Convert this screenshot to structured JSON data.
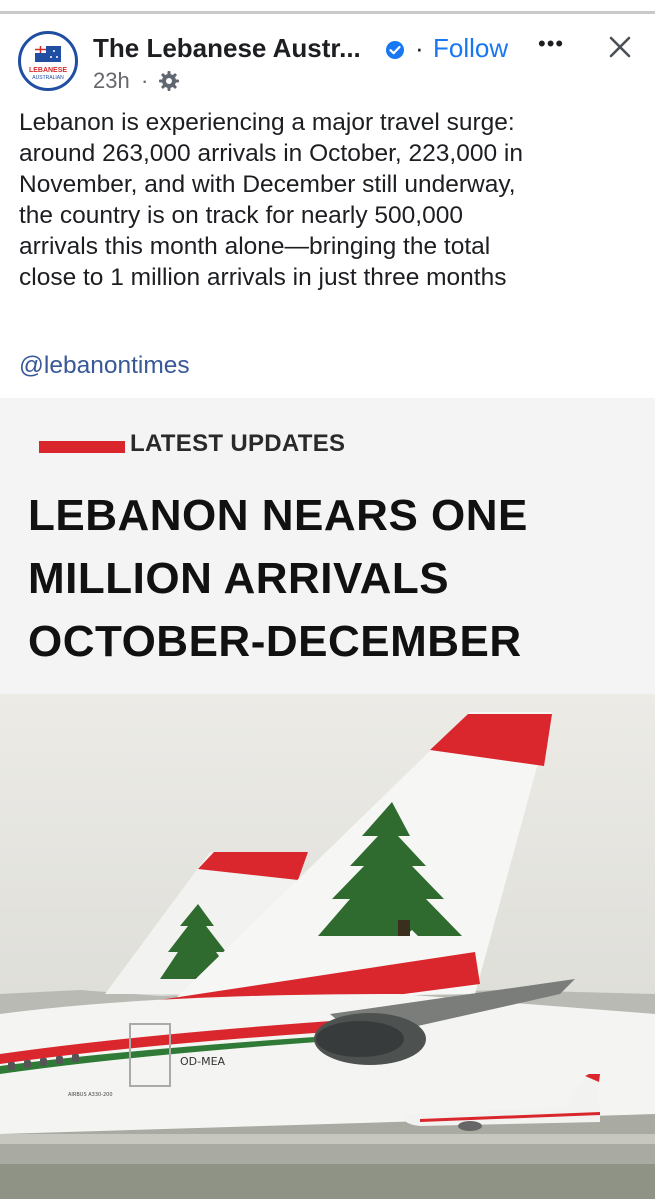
{
  "post": {
    "page_name": "The Lebanese Austr...",
    "separator": "·",
    "follow_label": "Follow",
    "more_label": "•••",
    "time": "23h",
    "time_sep": "·",
    "avatar_text": "LEBANESE",
    "avatar_subtext": "AUSTRALIAN",
    "body_lines": [
      "Lebanon is experiencing a major travel surge:",
      "around 263,000 arrivals in October, 223,000 in",
      "November, and with December still underway,",
      "the country is on track for nearly 500,000",
      "arrivals this month alone—bringing the total",
      "close to 1 million arrivals in just three months"
    ],
    "hashtag": "@lebanontimes"
  },
  "banner": {
    "kicker": "LATEST UPDATES",
    "headline_lines": [
      "LEBANON NEARS ONE",
      "MILLION ARRIVALS",
      "OCTOBER-DECEMBER"
    ]
  },
  "photo": {
    "registration": "OD-MEA",
    "model_text": "AIRBUS A330-200"
  },
  "colors": {
    "accent_blue": "#1877f2",
    "brand_red": "#d8262c",
    "cedar_green": "#2f6b2f"
  }
}
